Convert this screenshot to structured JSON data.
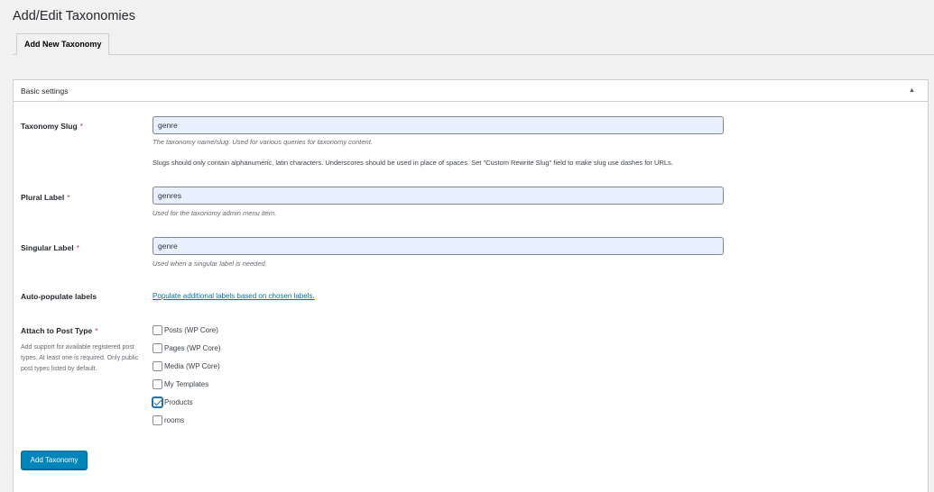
{
  "page": {
    "title": "Add/Edit Taxonomies"
  },
  "tabs": [
    {
      "label": "Add New Taxonomy"
    }
  ],
  "section": {
    "title": "Basic settings",
    "toggle_icon": "▲"
  },
  "fields": {
    "slug": {
      "label": "Taxonomy Slug",
      "required": "*",
      "value": "genre",
      "description": "The taxonomy name/slug. Used for various queries for taxonomy content.",
      "note": "Slugs should only contain alphanumeric, latin characters. Underscores should be used in place of spaces. Set \"Custom Rewrite Slug\" field to make slug use dashes for URLs."
    },
    "plural": {
      "label": "Plural Label",
      "required": "*",
      "value": "genres",
      "description": "Used for the taxonomy admin menu item."
    },
    "singular": {
      "label": "Singular Label",
      "required": "*",
      "value": "genre",
      "description": "Used when a singular label is needed."
    },
    "autopopulate": {
      "label": "Auto-populate labels",
      "link": "Populate additional labels based on chosen labels."
    },
    "post_types": {
      "label": "Attach to Post Type",
      "required": "*",
      "help": "Add support for available registered post types. At least one is required. Only public post types listed by default.",
      "options": [
        {
          "label": "Posts (WP Core)",
          "checked": false
        },
        {
          "label": "Pages (WP Core)",
          "checked": false
        },
        {
          "label": "Media (WP Core)",
          "checked": false
        },
        {
          "label": "My Templates",
          "checked": false
        },
        {
          "label": "Products",
          "checked": true
        },
        {
          "label": "rooms",
          "checked": false
        }
      ]
    }
  },
  "actions": {
    "submit_label": "Add Taxonomy"
  },
  "colors": {
    "primary": "#0085ba",
    "link": "#0073aa",
    "required": "#dc3232",
    "input_bg": "#e8f0fe"
  }
}
